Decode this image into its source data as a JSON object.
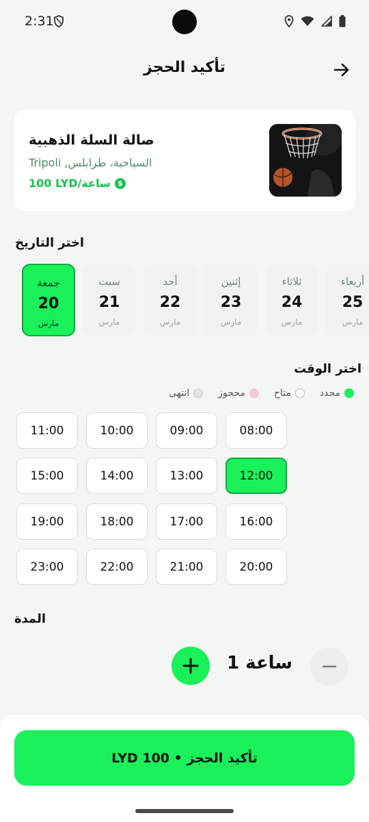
{
  "status_bar": {
    "time": "2:31"
  },
  "header": {
    "title": "تأكيد الحجز"
  },
  "venue": {
    "name": "صالة السلة الذهبية",
    "location": "Tripoli ,السياحية، طرابلس",
    "price": "100 LYD/ساعة"
  },
  "date_section": {
    "title": "اختر التاريخ",
    "dates": [
      {
        "day": "جمعة",
        "num": "20",
        "month": "مارس"
      },
      {
        "day": "سبت",
        "num": "21",
        "month": "مارس"
      },
      {
        "day": "أحد",
        "num": "22",
        "month": "مارس"
      },
      {
        "day": "إثنين",
        "num": "23",
        "month": "مارس"
      },
      {
        "day": "ثلاثاء",
        "num": "24",
        "month": "مارس"
      },
      {
        "day": "أربعاء",
        "num": "25",
        "month": "مارس"
      }
    ],
    "selected_index": 0
  },
  "time_section": {
    "title": "اختر الوقت",
    "legend": {
      "selected": "محدد",
      "available": "متاح",
      "booked": "محجوز",
      "expired": "انتهى"
    },
    "slots": [
      "08:00",
      "09:00",
      "10:00",
      "11:00",
      "12:00",
      "13:00",
      "14:00",
      "15:00",
      "16:00",
      "17:00",
      "18:00",
      "19:00",
      "20:00",
      "21:00",
      "22:00",
      "23:00"
    ],
    "selected_slot": "12:00"
  },
  "duration": {
    "title": "المدة",
    "value": "1 ساعة"
  },
  "confirm": {
    "label": "تأكيد الحجز • LYD 100"
  },
  "colors": {
    "accent": "#19f05a",
    "accent_border": "#12a83e",
    "booked": "#f6c9d3",
    "expired": "#e3e3e3",
    "price_text": "#17c14f"
  }
}
